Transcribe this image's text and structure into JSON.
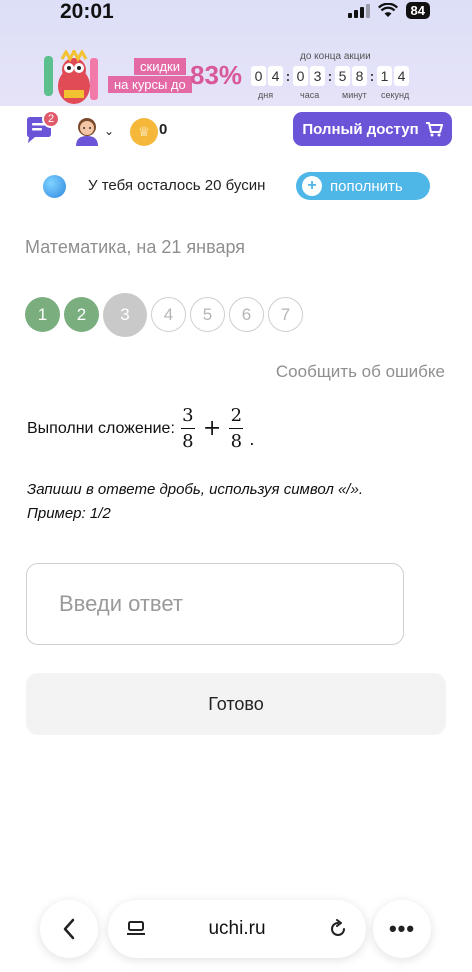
{
  "status_bar": {
    "time": "20:01",
    "battery": "84"
  },
  "promo": {
    "sale_line1": "скидки",
    "sale_line2": "на курсы до",
    "percent": "83%",
    "until_label": "до конца акции",
    "timer_digits": [
      "0",
      "4",
      "0",
      "3",
      "5",
      "8",
      "1",
      "4"
    ],
    "timer_labels": {
      "days": "дня",
      "hours": "часа",
      "minutes": "минут",
      "seconds": "секунд"
    }
  },
  "header": {
    "chat_badge": "2",
    "coins": "0",
    "full_access_label": "Полный доступ"
  },
  "beads": {
    "text": "У тебя осталось 20 бусин",
    "refill_label": "пополнить"
  },
  "page_title": "Математика, на 21 января",
  "steps": [
    {
      "label": "1",
      "state": "done"
    },
    {
      "label": "2",
      "state": "done"
    },
    {
      "label": "3",
      "state": "current"
    },
    {
      "label": "4",
      "state": "todo"
    },
    {
      "label": "5",
      "state": "todo"
    },
    {
      "label": "6",
      "state": "todo"
    },
    {
      "label": "7",
      "state": "todo"
    }
  ],
  "report_label": "Сообщить об ошибке",
  "task": {
    "prompt": "Выполни сложение:",
    "frac1": {
      "num": "3",
      "den": "8"
    },
    "op": "+",
    "frac2": {
      "num": "2",
      "den": "8"
    },
    "end": "."
  },
  "hint_line1": "Запиши в ответе дробь, используя символ «/».",
  "hint_line2": "Пример: 1/2",
  "answer": {
    "placeholder": "Введи ответ",
    "value": ""
  },
  "done_label": "Готово",
  "browser": {
    "url": "uchi.ru"
  },
  "colors": {
    "accent": "#6c54d8",
    "done_step": "#7aae7f",
    "sale_pink": "#e46aa6",
    "refill_blue": "#4fb6e8"
  }
}
